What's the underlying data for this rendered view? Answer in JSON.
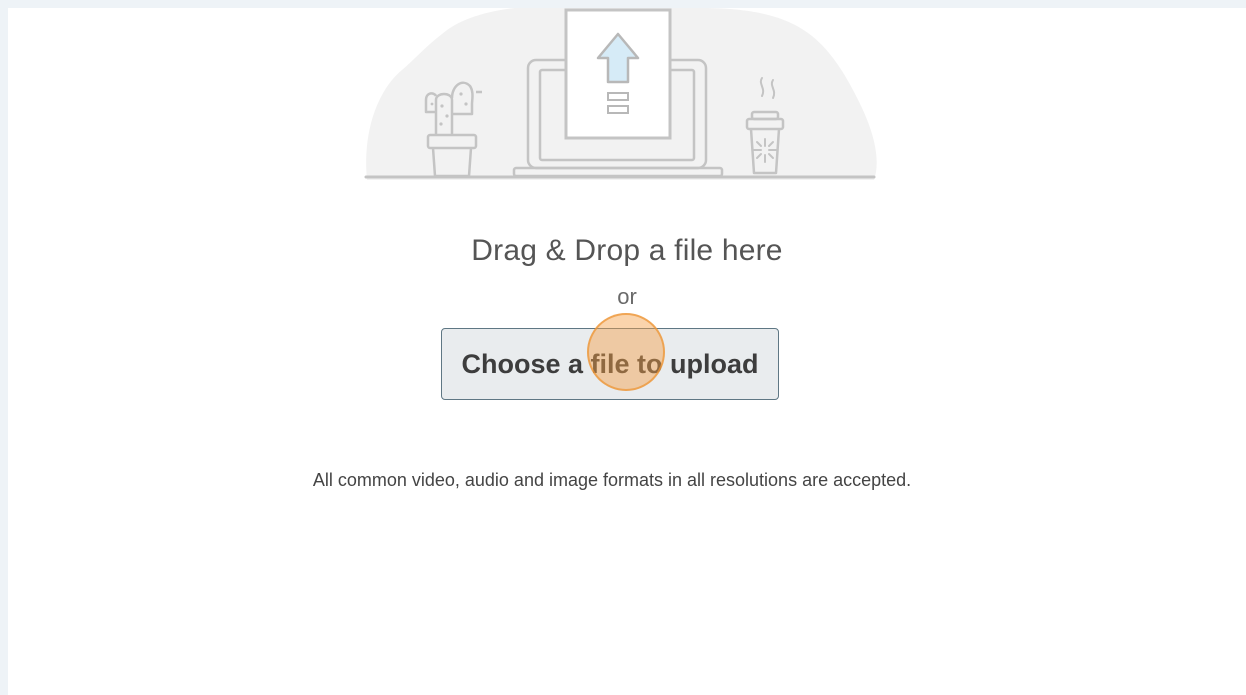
{
  "upload": {
    "headline": "Drag & Drop a file here",
    "or_text": "or",
    "choose_button_label": "Choose a file to upload",
    "formats_note": "All common video, audio and image formats in all resolutions are accepted."
  },
  "illustration": {
    "items": [
      "cactus-icon",
      "laptop-icon",
      "upload-arrow-icon",
      "coffee-cup-icon"
    ]
  },
  "colors": {
    "button_background": "#e9ecee",
    "button_border": "#5f7784",
    "cursor_highlight": "#f3a046",
    "arrow_fill": "#d6ebf7"
  }
}
